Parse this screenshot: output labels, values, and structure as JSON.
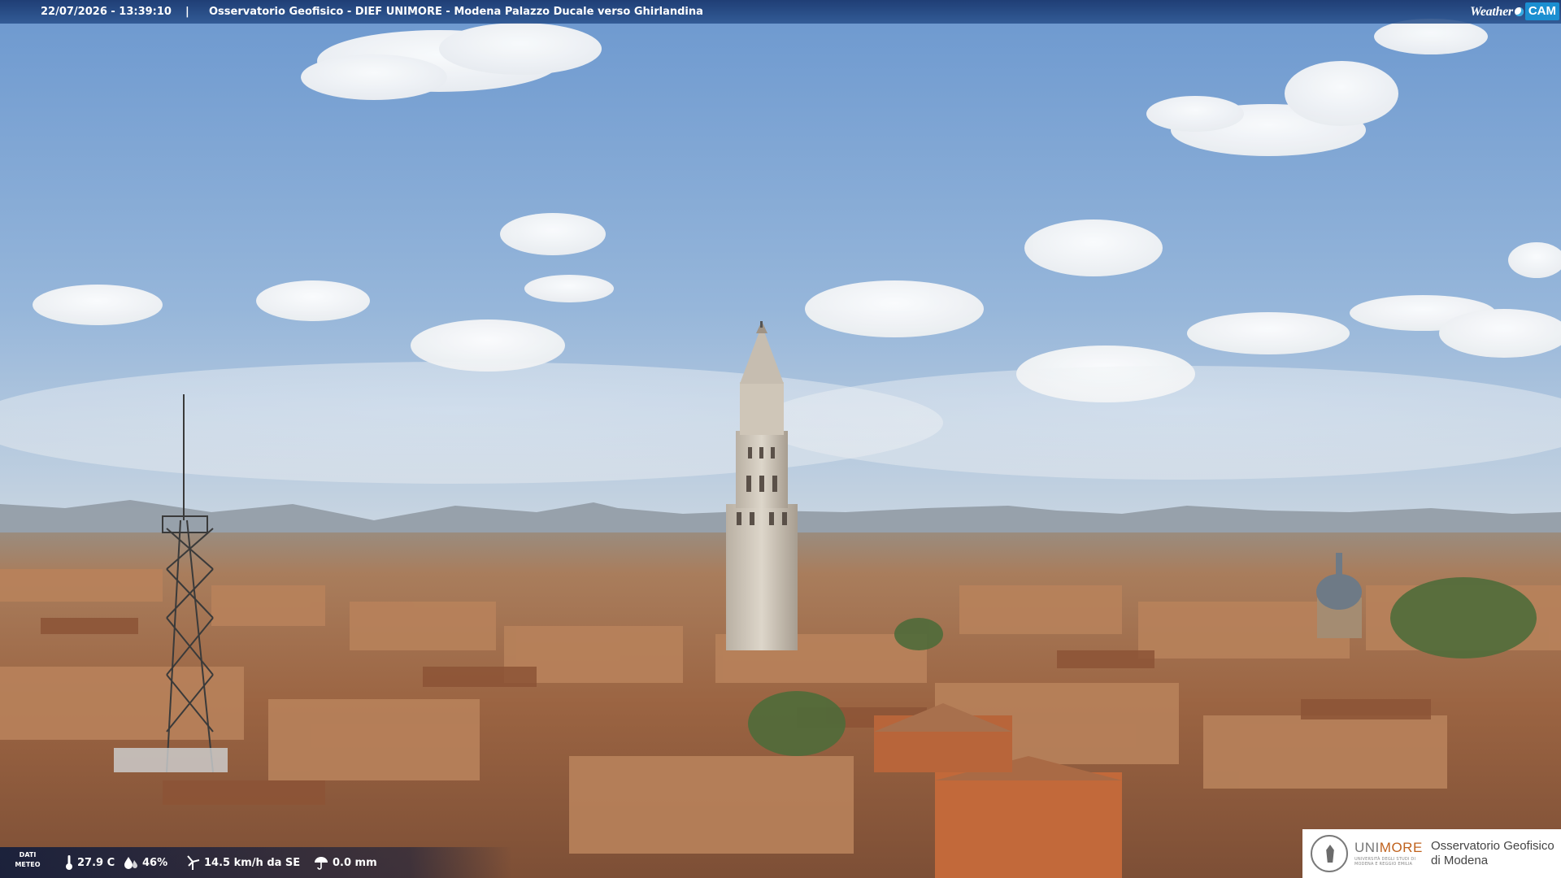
{
  "header": {
    "timestamp": "22/07/2026 - 13:39:10",
    "separator": "|",
    "camera_title": "Osservatorio Geofisico - DIEF UNIMORE - Modena Palazzo Ducale verso Ghirlandina",
    "logo_weather": "Weather",
    "logo_cam": "CAM"
  },
  "weather_strip": {
    "label_line1": "DATI",
    "label_line2": "METEO",
    "temperature": "27.9 C",
    "humidity": "46%",
    "wind": "14.5 km/h da SE",
    "rain": "0.0 mm"
  },
  "institution": {
    "brand_a": "UNI",
    "brand_b": "MORE",
    "brand_sub": "UNIVERSITÀ DEGLI STUDI DI MODENA E REGGIO EMILIA",
    "observatory_line1": "Osservatorio Geofisico",
    "observatory_line2": "di Modena"
  },
  "colors": {
    "sky_top": "#6f9bd0",
    "sky_horizon": "#dfe3e2",
    "roof": "#b57a4d",
    "banner": "#1e3d75",
    "cam_accent": "#1b8fd1",
    "unimore_orange": "#c0621e"
  }
}
